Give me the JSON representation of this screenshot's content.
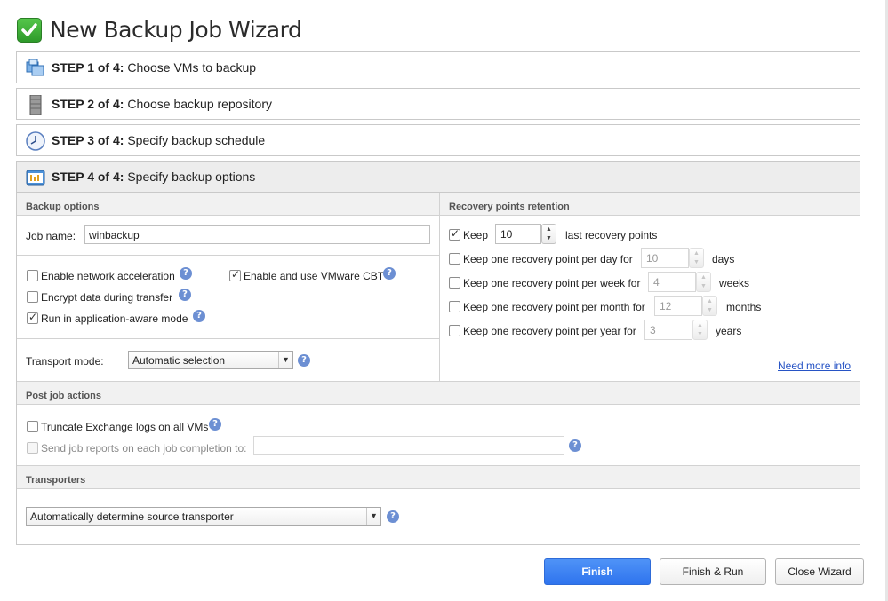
{
  "title": "New Backup Job Wizard",
  "steps": [
    {
      "prefix": "STEP 1 of 4:",
      "label": "Choose VMs to backup",
      "icon": "vm-icon"
    },
    {
      "prefix": "STEP 2 of 4:",
      "label": "Choose backup repository",
      "icon": "repository-icon"
    },
    {
      "prefix": "STEP 3 of 4:",
      "label": "Specify backup schedule",
      "icon": "clock-icon"
    },
    {
      "prefix": "STEP 4 of 4:",
      "label": "Specify backup options",
      "icon": "options-icon"
    }
  ],
  "backup_options": {
    "heading": "Backup options",
    "job_name_label": "Job name:",
    "job_name_value": "winbackup",
    "enable_network_acceleration": {
      "label": "Enable network acceleration",
      "checked": false
    },
    "encrypt_data": {
      "label": "Encrypt data during transfer",
      "checked": false
    },
    "app_aware": {
      "label": "Run in application-aware mode",
      "checked": true
    },
    "vmware_cbt": {
      "label": "Enable and use VMware CBT",
      "checked": true
    },
    "transport_label": "Transport mode:",
    "transport_value": "Automatic selection"
  },
  "retention": {
    "heading": "Recovery points retention",
    "keep_label": "Keep",
    "keep_value": "10",
    "keep_suffix": "last recovery points",
    "rows": [
      {
        "label": "Keep one recovery point per day for",
        "value": "10",
        "unit": "days"
      },
      {
        "label": "Keep one recovery point per week for",
        "value": "4",
        "unit": "weeks"
      },
      {
        "label": "Keep one recovery point per month for",
        "value": "12",
        "unit": "months"
      },
      {
        "label": "Keep one recovery point per year for",
        "value": "3",
        "unit": "years"
      }
    ],
    "more_info": "Need more info"
  },
  "post_job": {
    "heading": "Post job actions",
    "truncate_label": "Truncate Exchange logs on all VMs",
    "send_reports_label": "Send job reports on each job completion to:",
    "send_reports_value": ""
  },
  "transporters": {
    "heading": "Transporters",
    "value": "Automatically determine source transporter"
  },
  "buttons": {
    "finish": "Finish",
    "finish_run": "Finish & Run",
    "close": "Close Wizard"
  },
  "colors": {
    "primary_button": "#3a7ff2",
    "help_icon": "#6c8fd3",
    "link": "#2754c5"
  }
}
